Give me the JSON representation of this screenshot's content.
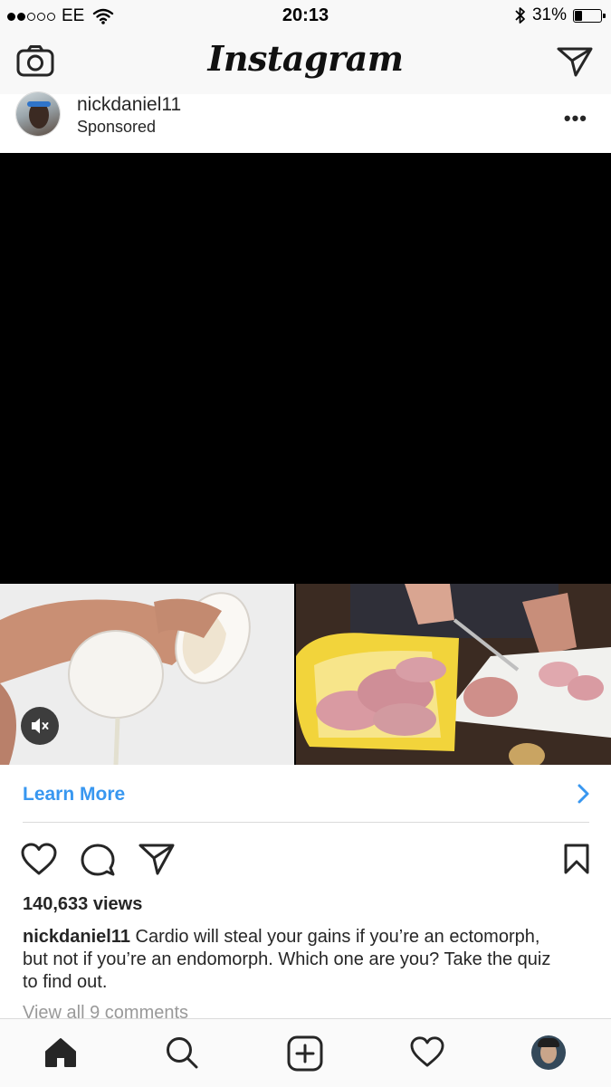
{
  "status_bar": {
    "carrier": "EE",
    "time": "20:13",
    "battery": "31%",
    "battery_level": 0.31
  },
  "header": {
    "logo": "Instagram",
    "icons": [
      "camera-icon",
      "direct-message-icon"
    ]
  },
  "post": {
    "username": "nickdaniel11",
    "label": "Sponsored",
    "more": "•••",
    "cta_label": "Learn More",
    "views": "140,633 views",
    "caption_user": "nickdaniel11",
    "caption_text": "Cardio will steal your gains if you’re an ectomorph, but not if you’re an endomorph. Which one are you? Take the quiz to find out.",
    "comments_link": "View all 9 comments"
  },
  "tab_bar": {
    "tabs": [
      "home-icon",
      "search-icon",
      "new-post-icon",
      "activity-icon",
      "profile-avatar"
    ]
  },
  "colors": {
    "link_blue": "#3897f0",
    "text": "#262626",
    "divider": "#dbdbdb"
  }
}
